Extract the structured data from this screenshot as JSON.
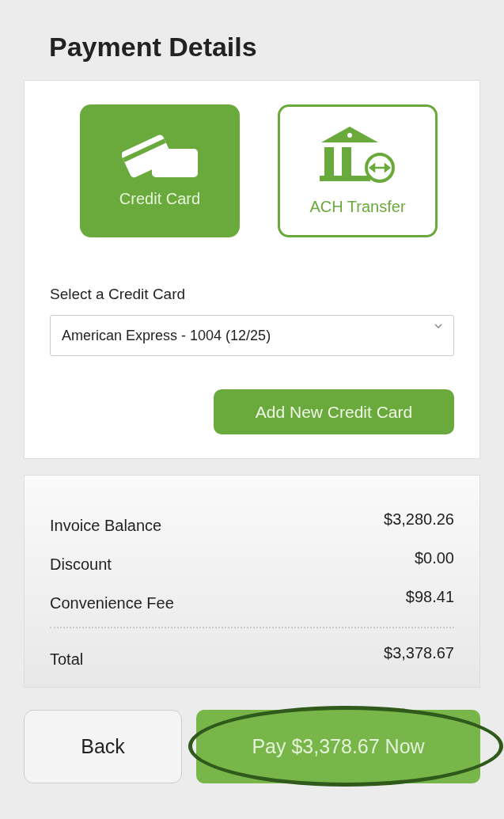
{
  "title": "Payment Details",
  "methods": [
    {
      "kind": "card",
      "label": "Credit Card",
      "selected": true
    },
    {
      "kind": "bank",
      "label": "ACH Transfer",
      "selected": false
    }
  ],
  "card_select": {
    "label": "Select a Credit Card",
    "value": "American Express - 1004 (12/25)"
  },
  "add_button": "Add New Credit Card",
  "summary": [
    {
      "label": "Invoice Balance",
      "amount": "$3,280.26"
    },
    {
      "label": "Discount",
      "amount": "$0.00"
    },
    {
      "label": "Convenience Fee",
      "amount": "$98.41"
    }
  ],
  "total": {
    "label": "Total",
    "amount": "$3,378.67"
  },
  "buttons": {
    "back": "Back",
    "pay": "Pay $3,378.67 Now"
  }
}
